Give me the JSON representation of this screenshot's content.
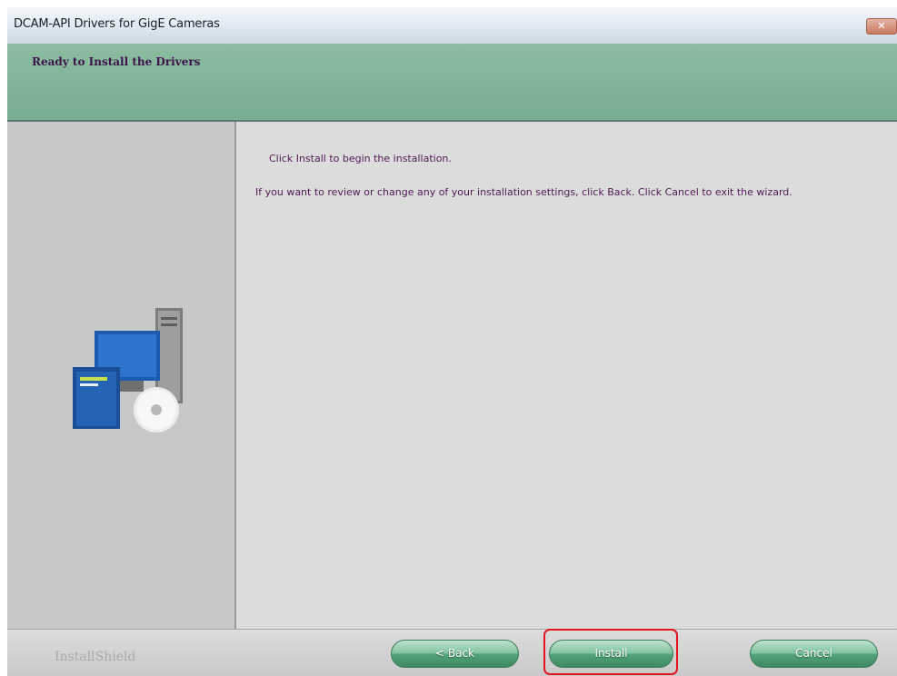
{
  "window": {
    "title": "DCAM-API Drivers for GigE Cameras",
    "close_glyph": "✕"
  },
  "header": {
    "title": "Ready to Install the Drivers"
  },
  "content": {
    "line1": "Click Install to begin the installation.",
    "line2": "If you want to review or change any of your installation settings, click Back. Click Cancel to exit the wizard."
  },
  "footer": {
    "brand": "InstallShield",
    "back_label": "< Back",
    "install_label": "Install",
    "cancel_label": "Cancel"
  },
  "colors": {
    "header_green": "#78ae93",
    "button_green": "#52a27a",
    "text_purple": "#501a55",
    "highlight_red": "#e2151f"
  }
}
